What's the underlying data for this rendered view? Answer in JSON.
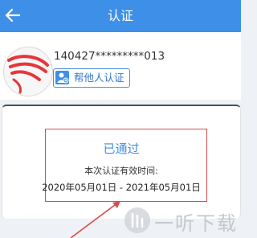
{
  "header": {
    "title": "认证",
    "back_icon": "arrow-left-icon",
    "background": "#3d8fe8"
  },
  "profile": {
    "id_number": "140427*********013",
    "help_button_label": "帮他人认证",
    "help_icon": "person-add-icon"
  },
  "status_card": {
    "status": "已通过",
    "validity_label": "本次认证有效时间:",
    "validity_range": "2020年05月01日 - 2021年05月01日",
    "status_color": "#3d8fe8"
  },
  "annotations": {
    "highlight_color": "#d94a4a"
  },
  "watermark": {
    "text": "一听下载"
  }
}
